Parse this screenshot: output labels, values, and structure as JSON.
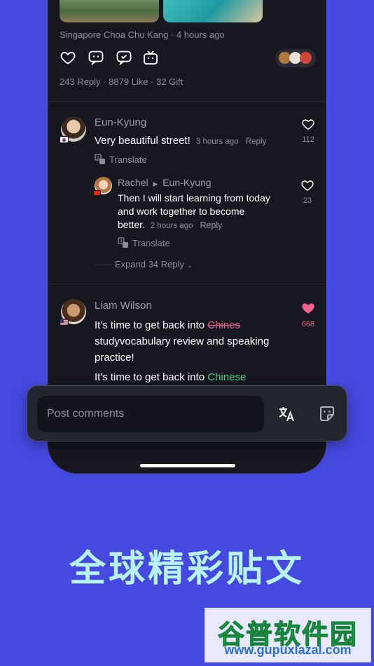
{
  "post": {
    "location": "Singapore Choa Chu Kang",
    "posted": "4 hours ago",
    "replies": "243 Reply",
    "likes": "8879 Like",
    "gifts": "32 Gift"
  },
  "comments": [
    {
      "name": "Eun-Kyung",
      "text": "Very beautiful street!",
      "time": "3 hours ago",
      "reply_label": "Reply",
      "translate_label": "Translate",
      "like_count": "112",
      "reply": {
        "name": "Rachel",
        "reply_to": "Eun-Kyung",
        "text_line1": "Then I will start learning from today",
        "text_line2": "and work together to become",
        "text_line3": "better.",
        "time": "2 hours ago",
        "reply_label": "Reply",
        "translate_label": "Translate",
        "like_count": "23"
      },
      "expand_label": "Expand 34 Reply"
    },
    {
      "name": "Liam Wilson",
      "text_prefix": "It's time to get back into",
      "text_wrong": "Chines",
      "text_line2": "studyvocabulary review and speaking",
      "text_line3": "practice!",
      "corrected_prefix": "It's time to get back into",
      "corrected_word": "Chinese",
      "like_count": "668"
    }
  ],
  "composer": {
    "placeholder": "Post comments"
  },
  "tagline": "全球精彩贴文",
  "watermark": {
    "title": "谷普软件园",
    "url": "www.gupuxlazal.com"
  },
  "colors": {
    "background": "#4549e0",
    "phone_bg": "#16171f",
    "like_active": "#f06292",
    "correction_green": "#4fd18b",
    "tagline": "#b6f3f1"
  }
}
